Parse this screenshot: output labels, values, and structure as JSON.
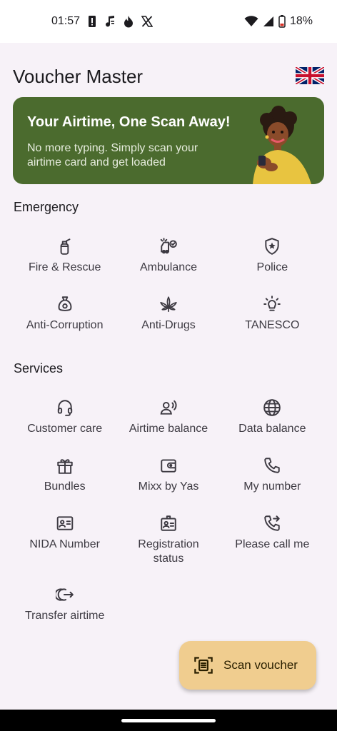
{
  "status_bar": {
    "time": "01:57",
    "battery": "18%",
    "left_icons": [
      "alert-icon",
      "music-note-icon",
      "flame-icon",
      "x-logo-icon"
    ],
    "right_icons": [
      "wifi-icon",
      "signal-icon",
      "battery-icon"
    ]
  },
  "header": {
    "title": "Voucher Master",
    "language_flag": "uk-flag-icon"
  },
  "banner": {
    "title": "Your Airtime, One Scan Away!",
    "subtitle": "No more typing. Simply scan your airtime card and get loaded",
    "background": "#4b6b2e"
  },
  "emergency": {
    "title": "Emergency",
    "items": [
      {
        "label": "Fire & Rescue",
        "icon": "fire-extinguisher-icon"
      },
      {
        "label": "Ambulance",
        "icon": "ambulance-icon"
      },
      {
        "label": "Police",
        "icon": "police-shield-icon"
      },
      {
        "label": "Anti-Corruption",
        "icon": "money-bag-icon"
      },
      {
        "label": "Anti-Drugs",
        "icon": "cannabis-leaf-icon"
      },
      {
        "label": "TANESCO",
        "icon": "light-bulb-icon"
      }
    ]
  },
  "services": {
    "title": "Services",
    "items": [
      {
        "label": "Customer care",
        "icon": "headset-icon"
      },
      {
        "label": "Airtime balance",
        "icon": "voice-person-icon"
      },
      {
        "label": "Data balance",
        "icon": "globe-icon"
      },
      {
        "label": "Bundles",
        "icon": "gift-icon"
      },
      {
        "label": "Mixx by Yas",
        "icon": "wallet-icon"
      },
      {
        "label": "My number",
        "icon": "phone-icon"
      },
      {
        "label": "NIDA Number",
        "icon": "id-card-icon"
      },
      {
        "label": "Registration status",
        "icon": "badge-icon"
      },
      {
        "label": "Please call me",
        "icon": "phone-forward-icon"
      },
      {
        "label": "Transfer airtime",
        "icon": "transfer-icon"
      }
    ]
  },
  "fab": {
    "label": "Scan voucher",
    "icon": "document-scanner-icon",
    "color": "#f0cd8f"
  }
}
